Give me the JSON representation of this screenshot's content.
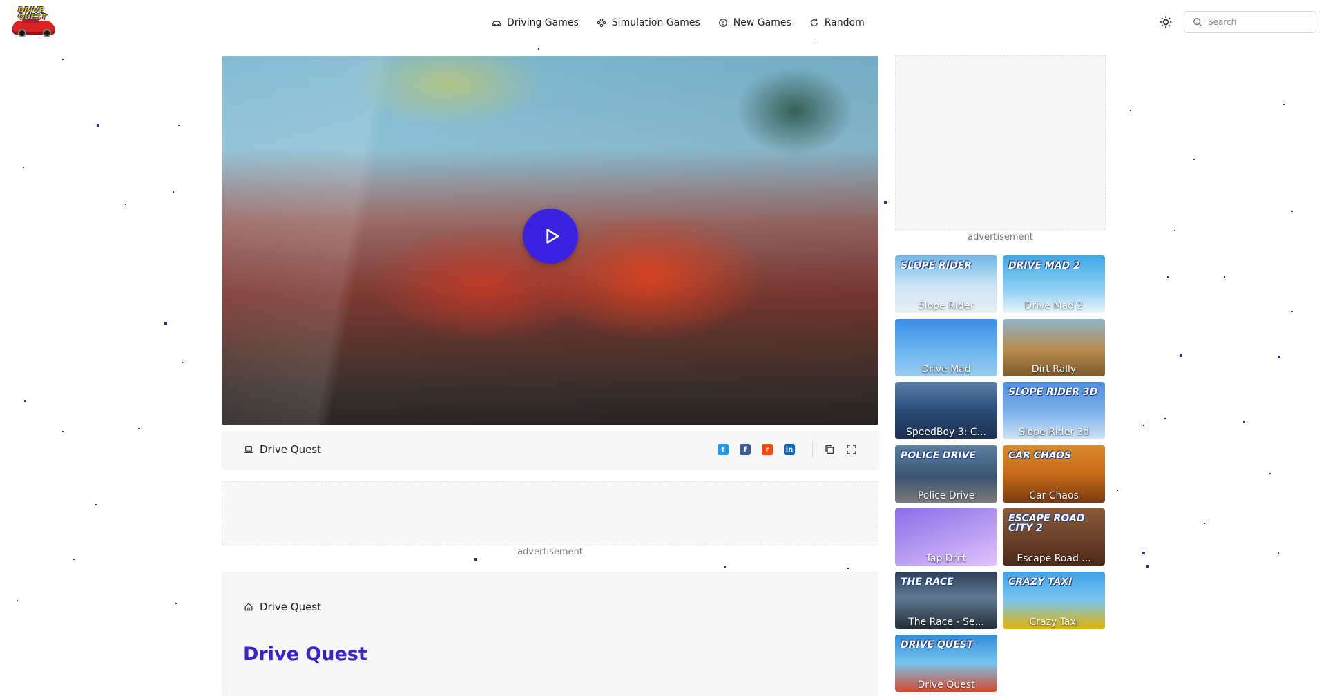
{
  "header": {
    "logo_text": "DRIVE\nQUEST",
    "nav": [
      {
        "label": "Driving Games",
        "icon": "car-icon"
      },
      {
        "label": "Simulation Games",
        "icon": "gamepad-icon"
      },
      {
        "label": "New Games",
        "icon": "clock-icon"
      },
      {
        "label": "Random",
        "icon": "refresh-icon"
      }
    ],
    "search_placeholder": "Search"
  },
  "player": {
    "game_title": "Drive Quest",
    "share": [
      {
        "name": "twitter",
        "color": "#1d9bf0"
      },
      {
        "name": "facebook",
        "color": "#3b5998"
      },
      {
        "name": "reddit",
        "color": "#ff4500"
      },
      {
        "name": "linkedin",
        "color": "#0a66c2"
      }
    ]
  },
  "ads": {
    "label_top": "advertisement",
    "label_mid": "advertisement"
  },
  "content": {
    "breadcrumb": "Drive Quest",
    "title": "Drive Quest"
  },
  "games": [
    {
      "name": "Slope Rider",
      "art": "SLOPE RIDER"
    },
    {
      "name": "Drive Mad 2",
      "art": "DRIVE MAD 2"
    },
    {
      "name": "Drive Mad",
      "art": ""
    },
    {
      "name": "Dirt Rally",
      "art": ""
    },
    {
      "name": "SpeedBoy 3: C...",
      "art": ""
    },
    {
      "name": "Slope Rider 3d",
      "art": "SLOPE RIDER 3D"
    },
    {
      "name": "Police Drive",
      "art": "POLICE DRIVE"
    },
    {
      "name": "Car Chaos",
      "art": "CAR CHAOS"
    },
    {
      "name": "Tap Drift",
      "art": ""
    },
    {
      "name": "Escape Road ...",
      "art": "ESCAPE ROAD CITY 2"
    },
    {
      "name": "The Race - Se...",
      "art": "THE RACE"
    },
    {
      "name": "Crazy Taxi",
      "art": "CRAZY TAXI"
    },
    {
      "name": "Drive Quest",
      "art": "DRIVE QUEST"
    }
  ]
}
